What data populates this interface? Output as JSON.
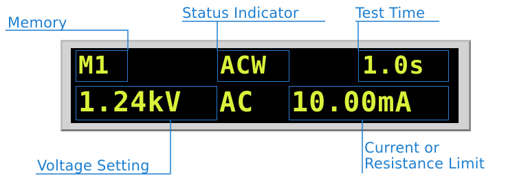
{
  "labels": {
    "memory": "Memory",
    "status_indicator": "Status Indicator",
    "test_time": "Test Time",
    "voltage_setting": "Voltage Setting",
    "current_limit_line1": "Current or",
    "current_limit_line2": "Resistance Limit"
  },
  "display": {
    "memory": "M1",
    "status": "ACW",
    "test_time": "1.0s",
    "voltage": "1.24kV",
    "mode": "AC",
    "current": "10.00mA"
  },
  "colors": {
    "label_text": "#1e7fd0",
    "segment_text": "#d9f23a",
    "screen_bg": "#000000",
    "bezel": "#d3d3d3",
    "highlight_box": "#2b7cd3"
  }
}
